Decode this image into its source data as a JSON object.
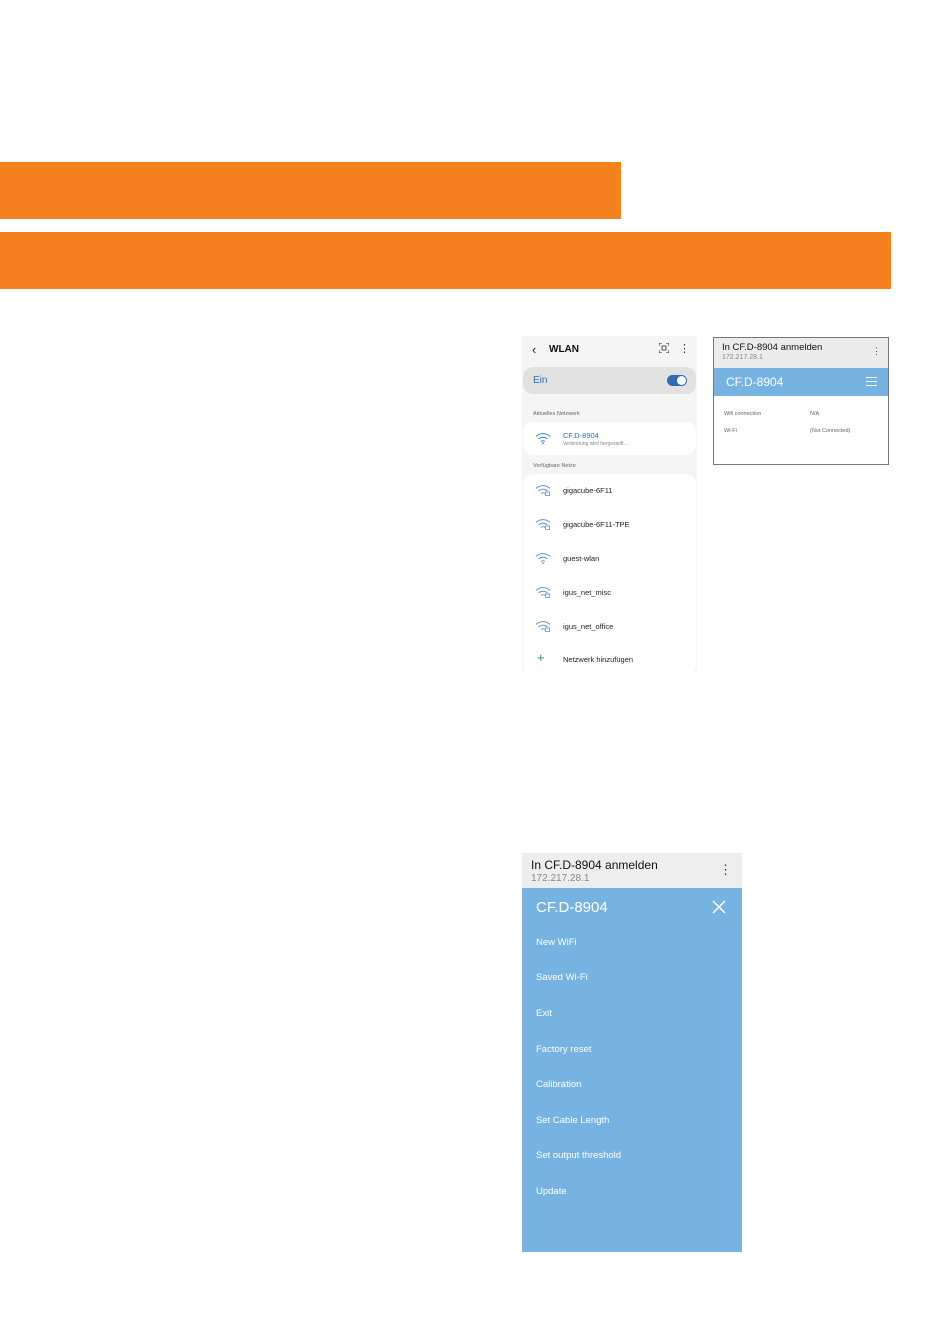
{
  "colors": {
    "orange": "#f5821f",
    "blue_panel": "#76b3e2",
    "android_blue": "#2f6db3",
    "add_green": "#2f9a6a"
  },
  "wlan": {
    "back_icon": "chevron-left-icon",
    "title": "WLAN",
    "qr_icon": "qr-scan-icon",
    "menu_icon": "more-vertical-icon",
    "toggle_label": "Ein",
    "toggle_on": true,
    "current_section": "Aktuelles Netzwerk",
    "current": {
      "name": "CF.D-8904",
      "status": "Verbindung wird hergestellt..."
    },
    "available_section": "Verfügbare Netze",
    "networks": [
      "gigacube-6F11",
      "gigacube-6F11-TPE",
      "guest-wlan",
      "igus_net_misc",
      "igus_net_office"
    ],
    "add_label": "Netzwerk hinzufügen"
  },
  "login_small": {
    "title": "In CF.D-8904 anmelden",
    "address": "172.217.28.1",
    "device": "CF.D-8904",
    "rows": [
      {
        "key": "Wifi connection",
        "value": "N/A"
      },
      {
        "key": "Wi-Fi",
        "value": "(Not Connected)"
      }
    ]
  },
  "login_menu": {
    "title": "In CF.D-8904 anmelden",
    "address": "172.217.28.1",
    "device": "CF.D-8904",
    "items": [
      "New WiFi",
      "Saved Wi-Fi",
      "Exit",
      "Factory reset",
      "Calibration",
      "Set Cable Length",
      "Set output threshold",
      "Update"
    ]
  }
}
